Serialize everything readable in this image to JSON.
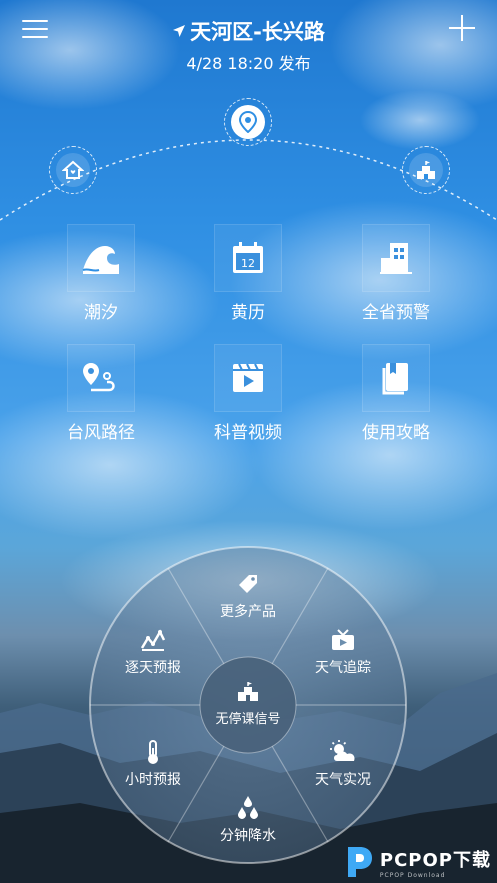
{
  "header": {
    "location": "天河区-长兴路",
    "publish_time": "4/28 18:20 发布"
  },
  "grid": [
    {
      "label": "潮汐",
      "icon": "wave-icon"
    },
    {
      "label": "黄历",
      "icon": "calendar-icon"
    },
    {
      "label": "全省预警",
      "icon": "building-icon"
    },
    {
      "label": "台风路径",
      "icon": "route-icon"
    },
    {
      "label": "科普视频",
      "icon": "video-icon"
    },
    {
      "label": "使用攻略",
      "icon": "book-icon"
    }
  ],
  "wheel": {
    "top": "更多产品",
    "upper_left": "逐天预报",
    "upper_right": "天气追踪",
    "lower_left": "小时预报",
    "lower_right": "天气实况",
    "bottom": "分钟降水",
    "center": "无停课信号"
  },
  "watermark": {
    "text": "PCPOP下载",
    "sub": "PCPOP Download"
  },
  "colors": {
    "sky_top": "#1f78d0",
    "sky_mid": "#4aa2ea",
    "accent": "#2f8fe3"
  }
}
